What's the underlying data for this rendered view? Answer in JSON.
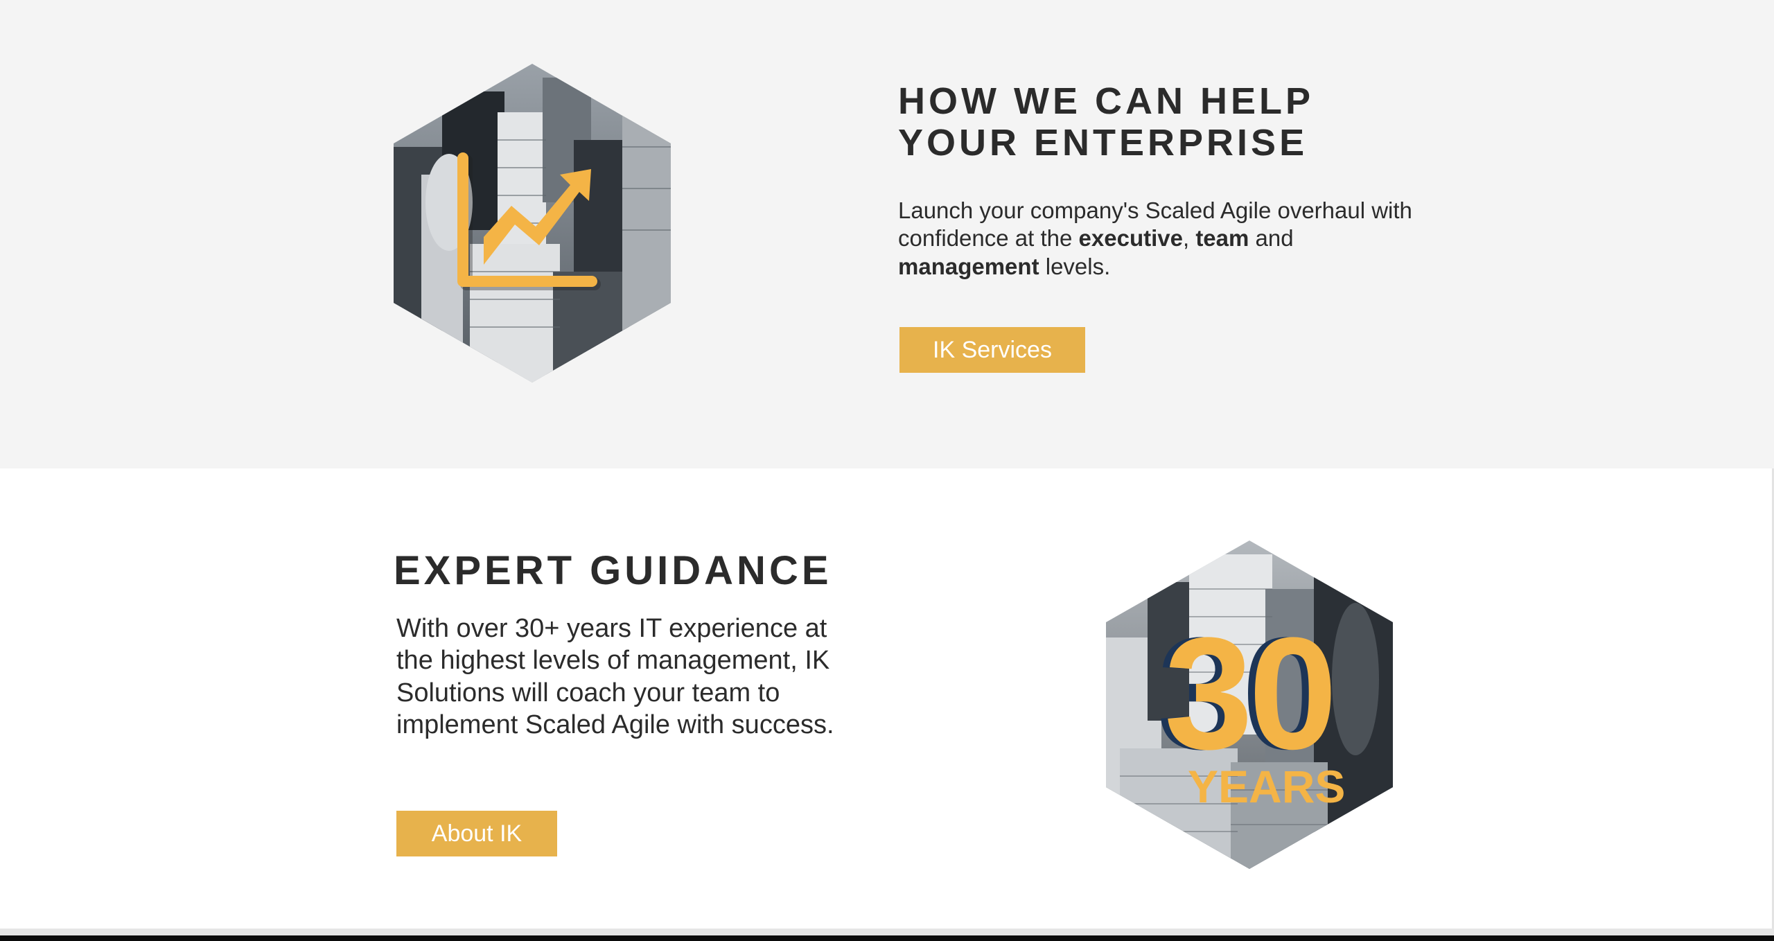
{
  "colors": {
    "accent": "#e7b24c",
    "text": "#2b2b2b",
    "band_gray": "#f4f4f4",
    "hex_accent_navy": "#1d3557"
  },
  "enterprise": {
    "heading_line1": "HOW WE CAN HELP",
    "heading_line2": "YOUR ENTERPRISE",
    "body_lead": "Launch your company's Scaled Agile overhaul with confidence at the ",
    "body_bold1": "executive",
    "body_sep": ", ",
    "body_bold2": "team",
    "body_and": " and ",
    "body_bold3": "management",
    "body_tail": " levels.",
    "button_label": "IK Services",
    "image_icon": "growth-chart-icon"
  },
  "guidance": {
    "heading": "EXPERT GUIDANCE",
    "body": "With over 30+ years IT experience at the highest levels of management, IK Solutions will coach your team to implement Scaled Agile with success.",
    "button_label": "About IK",
    "badge_number": "30",
    "badge_word": "YEARS"
  }
}
